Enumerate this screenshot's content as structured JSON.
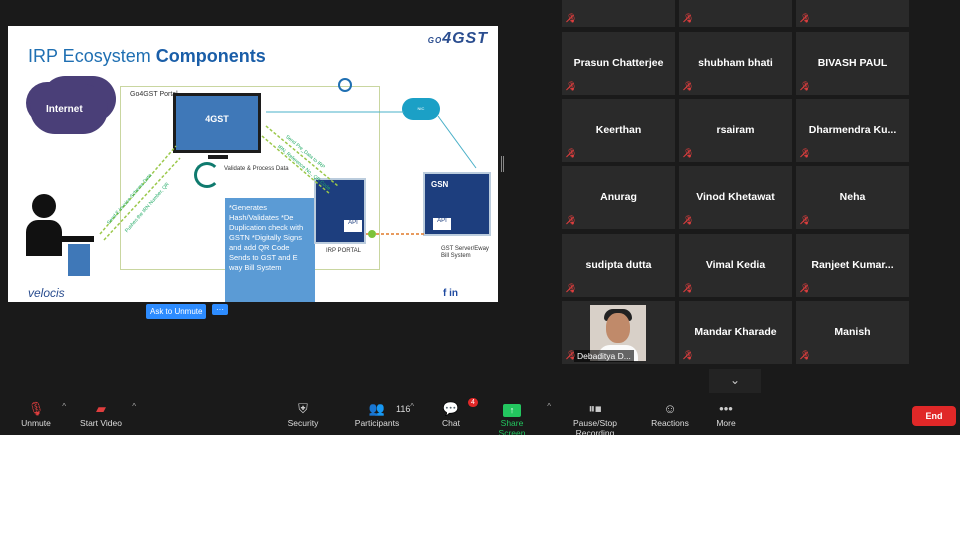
{
  "slide": {
    "title_light": "IRP Ecosystem",
    "title_bold": "Components",
    "brand_top": "4GST",
    "brand_prefix": "GO",
    "internet": "Internet",
    "portal": "Go4GST Portal",
    "monitor": "4GST",
    "validate": "Validate & Process Data",
    "bluebox": "*Generates Hash/Validates *De Duplication check with GSTN *Digitally Signs and add QR Code Sends to GST and E way Bill System",
    "irp_portal": "IRP PORTAL",
    "gst_server": "GST Server/Eway Bill System",
    "api": "API",
    "gsn": "GSN",
    "nic": "NIC",
    "velocis": "velocis",
    "social": "f in",
    "flows": [
      "Send E Invoice Schema Data",
      "Pushes the IRN Number, QR",
      "Send Pre_Data to IRP",
      "IRN, Reference No., QR Code"
    ]
  },
  "participants": [
    {
      "name": "Prasun Chatterjee",
      "muted": true
    },
    {
      "name": "shubham bhati",
      "muted": true
    },
    {
      "name": "BIVASH PAUL",
      "muted": true
    },
    {
      "name": "Keerthan",
      "muted": true
    },
    {
      "name": "rsairam",
      "muted": true
    },
    {
      "name": "Dharmendra  Ku...",
      "muted": true
    },
    {
      "name": "Anurag",
      "muted": true
    },
    {
      "name": "Vinod Khetawat",
      "muted": true
    },
    {
      "name": "Neha",
      "muted": true
    },
    {
      "name": "sudipta dutta",
      "muted": true
    },
    {
      "name": "Vimal Kedia",
      "muted": true
    },
    {
      "name": "Ranjeet  Kumar...",
      "muted": true
    },
    {
      "name": "Debaditya  D...",
      "muted": true,
      "has_video": true
    },
    {
      "name": "Mandar Kharade",
      "muted": true
    },
    {
      "name": "Manish",
      "muted": true
    }
  ],
  "tile_actions": {
    "ask_unmute": "Ask to Unmute",
    "more": "···"
  },
  "toolbar": {
    "unmute": "Unmute",
    "start_video": "Start Video",
    "security": "Security",
    "participants": "Participants",
    "participants_count": "116",
    "chat": "Chat",
    "chat_badge": "4",
    "share_screen": "Share Screen",
    "recording": "Pause/Stop Recording",
    "reactions": "Reactions",
    "more": "More",
    "end": "End"
  }
}
